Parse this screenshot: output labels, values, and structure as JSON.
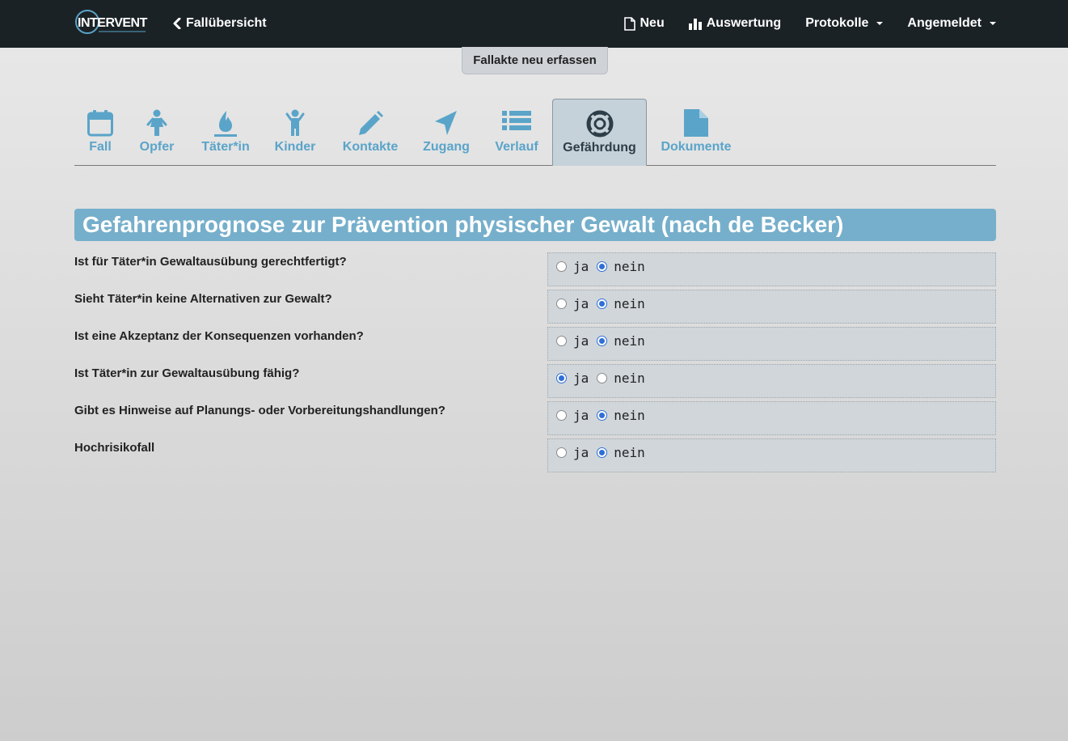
{
  "navbar": {
    "brand_text": "INTERVENT",
    "back_label": "Fallübersicht",
    "items": [
      {
        "label": "Neu",
        "icon": "file-icon"
      },
      {
        "label": "Auswertung",
        "icon": "bar-chart-icon"
      },
      {
        "label": "Protokolle",
        "dropdown": true
      },
      {
        "label": "Angemeldet",
        "dropdown": true
      }
    ]
  },
  "fallakte_button": "Fallakte neu erfassen",
  "tabs": [
    {
      "label": "Fall",
      "icon": "calendar-icon"
    },
    {
      "label": "Opfer",
      "icon": "child-icon"
    },
    {
      "label": "Täter*in",
      "icon": "fire-icon"
    },
    {
      "label": "Kinder",
      "icon": "child-arms-icon"
    },
    {
      "label": "Kontakte",
      "icon": "pencil-icon"
    },
    {
      "label": "Zugang",
      "icon": "location-arrow-icon"
    },
    {
      "label": "Verlauf",
      "icon": "list-icon"
    },
    {
      "label": "Gefährdung",
      "icon": "lifebuoy-icon",
      "active": true
    },
    {
      "label": "Dokumente",
      "icon": "document-icon"
    }
  ],
  "section_title": "Gefahrenprognose zur Prävention physischer Gewalt (nach de Becker)",
  "options": {
    "yes": "ja",
    "no": "nein"
  },
  "questions": [
    {
      "label": "Ist für Täter*in Gewaltausübung gerechtfertigt?",
      "answer": "nein"
    },
    {
      "label": "Sieht Täter*in keine Alternativen zur Gewalt?",
      "answer": "nein"
    },
    {
      "label": "Ist eine Akzeptanz der Konsequenzen vorhanden?",
      "answer": "nein"
    },
    {
      "label": "Ist Täter*in zur Gewaltausübung fähig?",
      "answer": "ja"
    },
    {
      "label": "Gibt es Hinweise auf Planungs- oder Vorbereitungshandlungen?",
      "answer": "nein"
    },
    {
      "label": "Hochrisikofall",
      "answer": "nein"
    }
  ],
  "colors": {
    "navbar": "#1b2226",
    "accent": "#5aa4c9",
    "section_header": "#76afcb"
  }
}
